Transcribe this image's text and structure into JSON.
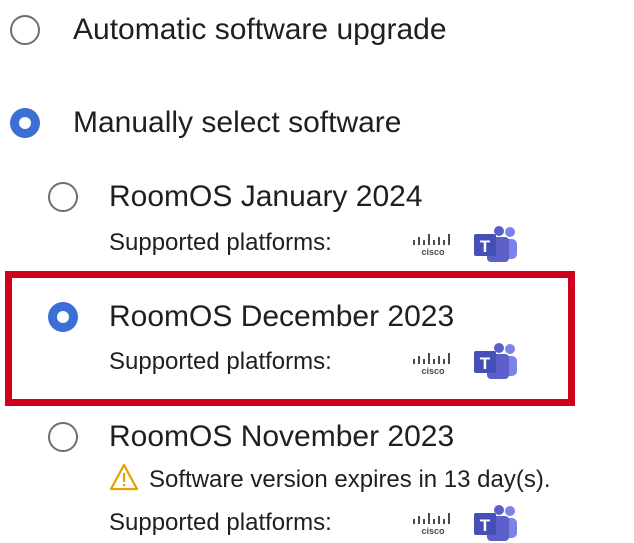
{
  "options": {
    "automatic": {
      "label": "Automatic software upgrade",
      "selected": false
    },
    "manual": {
      "label": "Manually select software",
      "selected": true
    }
  },
  "versions": [
    {
      "label": "RoomOS January 2024",
      "selected": false,
      "platforms_label": "Supported platforms:",
      "warning": ""
    },
    {
      "label": "RoomOS December 2023",
      "selected": true,
      "platforms_label": "Supported platforms:",
      "warning": ""
    },
    {
      "label": "RoomOS November 2023",
      "selected": false,
      "platforms_label": "Supported platforms:",
      "warning": "Software version expires in 13 day(s)."
    }
  ],
  "platforms": {
    "cisco": {
      "text": "cisco",
      "icon": "cisco-logo-icon"
    },
    "teams": {
      "text": "T",
      "icon": "microsoft-teams-icon"
    }
  },
  "colors": {
    "radio_selected": "#3b6fd6",
    "highlight_border": "#d0021b",
    "warning": "#e8a000",
    "teams_purple": "#5b5fc7"
  }
}
